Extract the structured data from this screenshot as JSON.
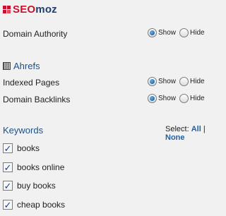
{
  "seomoz": {
    "logo_text_seo": "SEO",
    "logo_text_moz": "moz",
    "brand_color": "#c8102e",
    "rows": [
      {
        "label": "Domain Authority",
        "show_label": "Show",
        "hide_label": "Hide",
        "selected": "show"
      }
    ]
  },
  "ahrefs": {
    "title": "Ahrefs",
    "rows": [
      {
        "label": "Indexed Pages",
        "show_label": "Show",
        "hide_label": "Hide",
        "selected": "show"
      },
      {
        "label": "Domain Backlinks",
        "show_label": "Show",
        "hide_label": "Hide",
        "selected": "show"
      }
    ]
  },
  "keywords": {
    "title": "Keywords",
    "select_prefix": "Select:",
    "select_all": "All",
    "separator": "|",
    "select_none": "None",
    "items": [
      {
        "label": "books",
        "checked": true
      },
      {
        "label": "books online",
        "checked": true
      },
      {
        "label": "buy books",
        "checked": true
      },
      {
        "label": "cheap books",
        "checked": true
      }
    ]
  },
  "colors": {
    "heading_blue": "#1f4f8a",
    "link_blue": "#1f5fa5"
  }
}
